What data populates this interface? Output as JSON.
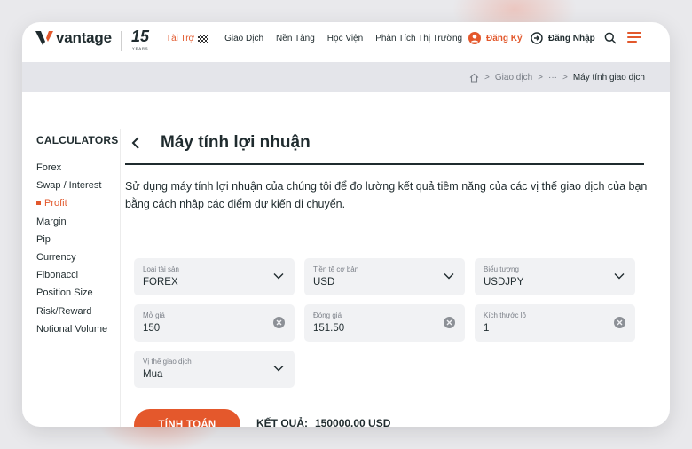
{
  "header": {
    "brand": "vantage",
    "anniversary": "15",
    "anniversary_sub": "YEARS",
    "nav": [
      {
        "label": "Tài Trợ"
      },
      {
        "label": "Giao Dịch"
      },
      {
        "label": "Nền Tảng"
      },
      {
        "label": "Học Viện"
      },
      {
        "label": "Phân Tích Thị Trường"
      }
    ],
    "register_label": "Đăng Ký",
    "login_label": "Đăng Nhập"
  },
  "breadcrumb": {
    "items": [
      "Giao dịch",
      "···",
      "Máy tính giao dịch"
    ]
  },
  "sidebar": {
    "title": "CALCULATORS",
    "items": [
      {
        "label": "Forex"
      },
      {
        "label": "Swap / Interest"
      },
      {
        "label": "Profit"
      },
      {
        "label": "Margin"
      },
      {
        "label": "Pip"
      },
      {
        "label": "Currency"
      },
      {
        "label": "Fibonacci"
      },
      {
        "label": "Position Size"
      },
      {
        "label": "Risk/Reward"
      },
      {
        "label": "Notional Volume"
      }
    ],
    "active_index": 2
  },
  "main": {
    "title": "Máy tính lợi nhuận",
    "description": "Sử dụng máy tính lợi nhuận của chúng tôi để đo lường kết quả tiềm năng của các vị thế giao dịch của bạn bằng cách nhập các điểm dự kiến di chuyển.",
    "fields": {
      "asset_type": {
        "label": "Loại tài sản",
        "value": "FOREX"
      },
      "base_currency": {
        "label": "Tiền tệ cơ bản",
        "value": "USD"
      },
      "symbol": {
        "label": "Biểu tượng",
        "value": "USDJPY"
      },
      "open_price": {
        "label": "Mở giá",
        "value": "150"
      },
      "close_price": {
        "label": "Đóng giá",
        "value": "151.50"
      },
      "lot_size": {
        "label": "Kích thước lô",
        "value": "1"
      },
      "position": {
        "label": "Vị thế giao dịch",
        "value": "Mua"
      }
    },
    "calculate_label": "TÍNH TOÁN",
    "result_label": "KẾT QUẢ:",
    "result_value": "150000.00 USD"
  },
  "colors": {
    "accent": "#e4582c",
    "text": "#1f2b2e",
    "field_bg": "#f1f2f4",
    "crumb_bg": "#e4e5ea"
  }
}
